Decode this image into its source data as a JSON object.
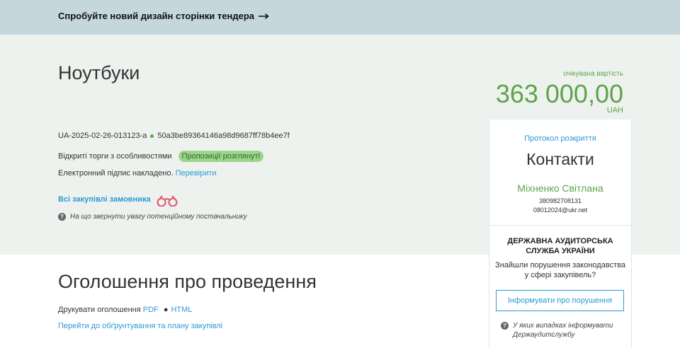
{
  "banner": {
    "text": "Спробуйте новий дизайн сторінки тендера",
    "arrow_icon": "long-arrow-right-icon"
  },
  "tender": {
    "title": "Ноутбуки",
    "id": "UA-2025-02-26-013123-a",
    "hash": "50a3be89364146a98d9687ff78b4ee7f",
    "procedure_type": "Відкриті торги з особливостями",
    "status_badge": "Пропозиції розглянуті",
    "signature_text": "Електронний підпис накладено.",
    "signature_verify_link": "Перевірити",
    "all_purchases_link": "Всі закупівлі замовника",
    "hint_text": "На що звернути увагу потенційному постачальнику"
  },
  "expected_value": {
    "label": "очікувана вартість",
    "amount": "363 000,00",
    "currency": "UAH"
  },
  "contacts_panel": {
    "protocol_link": "Протокол розкриття",
    "title": "Контакти",
    "person_name": "Міхненко Світлана",
    "phone": "380982708131",
    "email": "08012024@ukr.net"
  },
  "audit": {
    "title": "ДЕРЖАВНА АУДИТОРСЬКА СЛУЖБА УКРАЇНИ",
    "question": "Знайшли порушення законодавства у сфері закупівель?",
    "button_label": "Інформувати про порушення",
    "hint_text": "У яких випадках інформувати Держаудитслужбу"
  },
  "announcement": {
    "title": "Оголошення про проведення",
    "print_label": "Друкувати оголошення",
    "pdf_link": "PDF",
    "separator": "●",
    "html_link": "HTML",
    "plan_link": "Перейти до обґрунтування та плану закупівлі"
  },
  "colors": {
    "banner_bg": "#c5d6dd",
    "hero_bg": "#eef2ee",
    "accent_green": "#5ea34b",
    "link_blue": "#2a9ad6",
    "badge_bg": "#9fd48c"
  }
}
